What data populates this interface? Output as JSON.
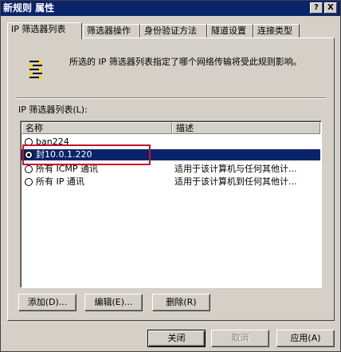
{
  "window": {
    "title": "新规则 属性",
    "help_label": "?",
    "close_label": "X"
  },
  "tabs": [
    {
      "label": "IP 筛选器列表",
      "active": true
    },
    {
      "label": "筛选器操作",
      "active": false
    },
    {
      "label": "身份验证方法",
      "active": false
    },
    {
      "label": "隧道设置",
      "active": false
    },
    {
      "label": "连接类型",
      "active": false
    }
  ],
  "description": "所选的 IP 筛选器列表指定了哪个网络传输将受此规则影响。",
  "list": {
    "label": "IP 筛选器列表(L):",
    "columns": [
      "名称",
      "描述"
    ],
    "rows": [
      {
        "name": "ban224",
        "desc": "",
        "selected": false,
        "checked": false
      },
      {
        "name": "封10.0.1.220",
        "desc": "",
        "selected": true,
        "checked": true
      },
      {
        "name": "所有 ICMP 通讯",
        "desc": "适用于该计算机与任何其他计...",
        "selected": false,
        "checked": false
      },
      {
        "name": "所有 IP 通讯",
        "desc": "适用于该计算机到任何其他计...",
        "selected": false,
        "checked": false
      }
    ]
  },
  "buttons": {
    "add": "添加(D)...",
    "edit": "编辑(E)...",
    "remove": "删除(R)"
  },
  "footer": {
    "close": "关闭",
    "cancel": "取消",
    "apply": "应用(A)"
  },
  "colors": {
    "selection": "#0a246a",
    "highlight_box": "#c8102e",
    "face": "#d4d0c8"
  }
}
